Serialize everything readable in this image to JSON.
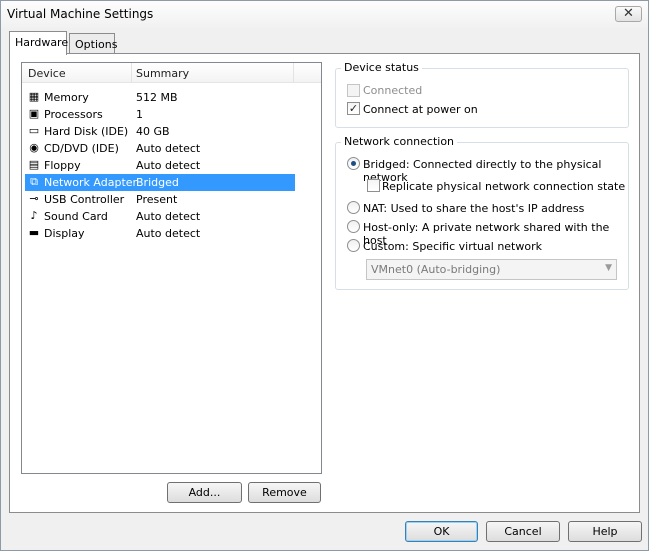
{
  "window": {
    "title": "Virtual Machine Settings"
  },
  "tabs": [
    {
      "label": "Hardware"
    },
    {
      "label": "Options"
    }
  ],
  "device_list": {
    "columns": [
      "Device",
      "Summary"
    ],
    "rows": [
      {
        "name": "Memory",
        "summary": "512 MB",
        "icon": "memory-icon",
        "glyph": "▦"
      },
      {
        "name": "Processors",
        "summary": "1",
        "icon": "processor-icon",
        "glyph": "▣"
      },
      {
        "name": "Hard Disk (IDE)",
        "summary": "40 GB",
        "icon": "hard-disk-icon",
        "glyph": "▭"
      },
      {
        "name": "CD/DVD (IDE)",
        "summary": "Auto detect",
        "icon": "cd-dvd-icon",
        "glyph": "◉"
      },
      {
        "name": "Floppy",
        "summary": "Auto detect",
        "icon": "floppy-icon",
        "glyph": "▤"
      },
      {
        "name": "Network Adapter",
        "summary": "Bridged",
        "icon": "network-adapter-icon",
        "glyph": "⧉"
      },
      {
        "name": "USB Controller",
        "summary": "Present",
        "icon": "usb-icon",
        "glyph": "⊸"
      },
      {
        "name": "Sound Card",
        "summary": "Auto detect",
        "icon": "sound-card-icon",
        "glyph": "♪"
      },
      {
        "name": "Display",
        "summary": "Auto detect",
        "icon": "display-icon",
        "glyph": "▬"
      }
    ]
  },
  "list_buttons": {
    "add": "Add...",
    "remove": "Remove"
  },
  "device_status": {
    "title": "Device status",
    "connected": "Connected",
    "connect_at_power_on": "Connect at power on"
  },
  "network_connection": {
    "title": "Network connection",
    "bridged": "Bridged: Connected directly to the physical network",
    "replicate": "Replicate physical network connection state",
    "nat": "NAT: Used to share the host's IP address",
    "host_only": "Host-only: A private network shared with the host",
    "custom": "Custom: Specific virtual network",
    "custom_network_value": "VMnet0 (Auto-bridging)"
  },
  "footer": {
    "ok": "OK",
    "cancel": "Cancel",
    "help": "Help"
  }
}
